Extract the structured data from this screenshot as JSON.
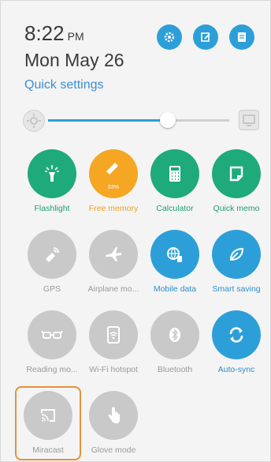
{
  "header": {
    "time": "8:22",
    "ampm": "PM",
    "date": "Mon May 26",
    "quick_settings_label": "Quick settings"
  },
  "header_icons": [
    "settings-icon",
    "edit-icon",
    "notes-icon"
  ],
  "brightness": {
    "level_percent": 66
  },
  "tiles": [
    {
      "label": "Flashlight",
      "icon": "flashlight-icon",
      "state": "on-green"
    },
    {
      "label": "Free memory",
      "icon": "broom-icon",
      "state": "on-orange",
      "sub": "83%"
    },
    {
      "label": "Calculator",
      "icon": "calculator-icon",
      "state": "on-green"
    },
    {
      "label": "Quick memo",
      "icon": "memo-icon",
      "state": "on-green"
    },
    {
      "label": "GPS",
      "icon": "gps-icon",
      "state": "off"
    },
    {
      "label": "Airplane mo...",
      "icon": "airplane-icon",
      "state": "off"
    },
    {
      "label": "Mobile data",
      "icon": "mobile-data-icon",
      "state": "on-blue"
    },
    {
      "label": "Smart saving",
      "icon": "leaf-icon",
      "state": "on-blue"
    },
    {
      "label": "Reading mo...",
      "icon": "glasses-icon",
      "state": "off"
    },
    {
      "label": "Wi-Fi hotspot",
      "icon": "hotspot-icon",
      "state": "off"
    },
    {
      "label": "Bluetooth",
      "icon": "bluetooth-icon",
      "state": "off"
    },
    {
      "label": "Auto-sync",
      "icon": "sync-icon",
      "state": "on-blue"
    },
    {
      "label": "Miracast",
      "icon": "cast-icon",
      "state": "off"
    },
    {
      "label": "Glove mode",
      "icon": "hand-icon",
      "state": "off"
    }
  ],
  "colors": {
    "accent_blue": "#2d9fd8",
    "green": "#1faa7c",
    "orange": "#f5a623",
    "off_gray": "#c9c9c9",
    "highlight_orange": "#e8913b"
  }
}
